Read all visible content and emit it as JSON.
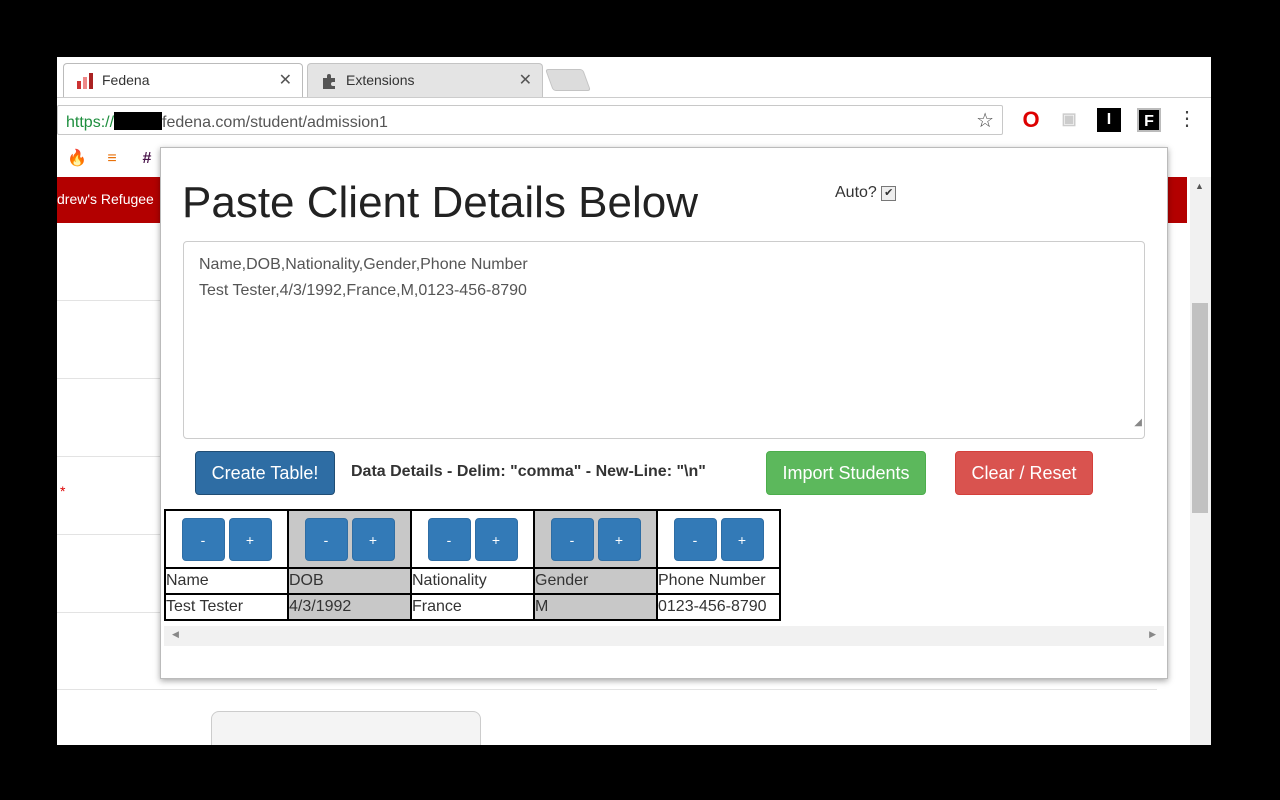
{
  "browser": {
    "tabs": [
      {
        "title": "Fedena",
        "close": "✕"
      },
      {
        "title": "Extensions",
        "close": "✕"
      }
    ],
    "url": {
      "scheme": "https://",
      "host_suffix": "fedena.com",
      "path": "/student/admission1"
    },
    "star_icon": "☆",
    "menu_icon": "⋮",
    "extensions": [
      {
        "name": "opera-icon",
        "glyph": "O"
      },
      {
        "name": "grey-extension-icon",
        "glyph": "▣"
      },
      {
        "name": "i-extension-icon",
        "glyph": "I"
      },
      {
        "name": "f-extension-icon",
        "glyph": "F"
      }
    ],
    "bookmarks": [
      {
        "name": "firebase-icon",
        "glyph": "🔥"
      },
      {
        "name": "stackoverflow-icon",
        "glyph": "≡"
      },
      {
        "name": "slack-icon",
        "glyph": "#"
      }
    ]
  },
  "page": {
    "header_text": "drew's Refugee",
    "required_marker": "*"
  },
  "popup": {
    "title": "Paste Client Details Below",
    "auto_label": "Auto?",
    "auto_checked": "✔",
    "textarea_lines": [
      "Name,DOB,Nationality,Gender,Phone Number",
      "Test Tester,4/3/1992,France,M,0123-456-8790"
    ],
    "create_button": "Create Table!",
    "data_details": "Data Details - Delim: \"comma\" - New-Line: \"\\n\"",
    "import_button": "Import Students",
    "clear_button": "Clear / Reset",
    "minus_label": "-",
    "plus_label": "+",
    "table": {
      "headers": [
        "Name",
        "DOB",
        "Nationality",
        "Gender",
        "Phone Number"
      ],
      "rows": [
        [
          "Test Tester",
          "4/3/1992",
          "France",
          "M",
          "0123-456-8790"
        ]
      ]
    },
    "scroll_left": "◀",
    "scroll_right": "▶"
  },
  "colors": {
    "primary": "#337ab7",
    "success": "#5cb85c",
    "danger": "#d9534f",
    "header_red": "#b30000",
    "alt_column": "#c8c8c8"
  }
}
